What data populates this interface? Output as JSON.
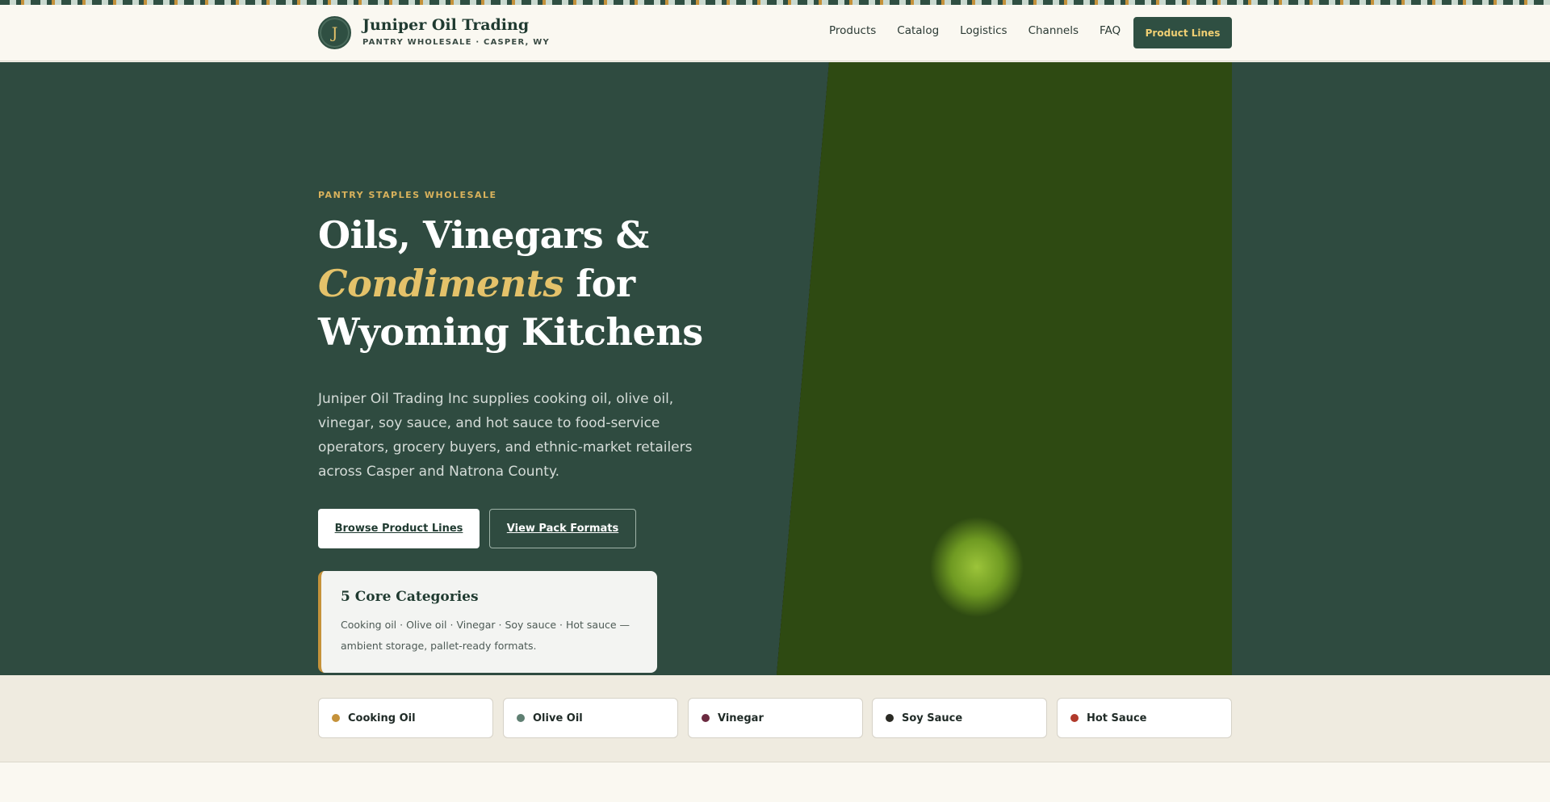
{
  "header": {
    "logo_letter": "J",
    "brand_name": "Juniper Oil Trading",
    "brand_subtitle": "PANTRY WHOLESALE · CASPER, WY",
    "nav": [
      "Products",
      "Catalog",
      "Logistics",
      "Channels",
      "FAQ"
    ],
    "cta_label": "Product Lines"
  },
  "hero": {
    "eyebrow": "PANTRY STAPLES WHOLESALE",
    "title_part1": "Oils, Vinegars &",
    "title_highlight": "Condiments",
    "title_part2": "for",
    "title_part3": "Wyoming Kitchens",
    "description": "Juniper Oil Trading Inc supplies cooking oil, olive oil, vinegar, soy sauce, and hot sauce to food-service operators, grocery buyers, and ethnic-market retailers across Casper and Natrona County.",
    "primary_button": "Browse Product Lines",
    "secondary_button": "View Pack Formats",
    "card": {
      "title": "5 Core Categories",
      "text": "Cooking oil · Olive oil · Vinegar · Soy sauce · Hot sauce — ambient storage, pallet-ready formats."
    },
    "image": "olive-oil-bottle-with-olives"
  },
  "categories": [
    {
      "label": "Cooking Oil",
      "color": "#c5923a"
    },
    {
      "label": "Olive Oil",
      "color": "#5f7f72"
    },
    {
      "label": "Vinegar",
      "color": "#6b2a40"
    },
    {
      "label": "Soy Sauce",
      "color": "#2a2a24"
    },
    {
      "label": "Hot Sauce",
      "color": "#b0392b"
    }
  ],
  "colors": {
    "forest": "#2f4b40",
    "gold": "#e4c26a",
    "accent_bar": "#c5923a",
    "cream": "#faf8f1"
  }
}
